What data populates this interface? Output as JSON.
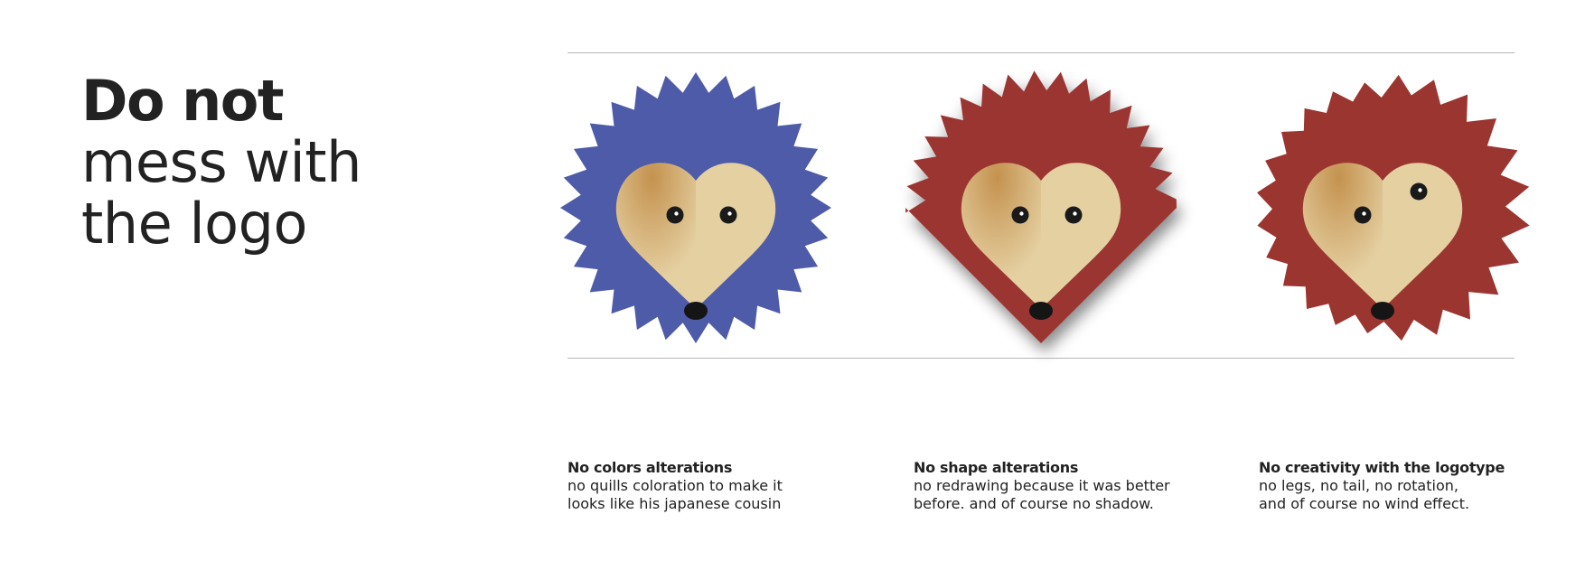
{
  "headline": {
    "line1": "Do not",
    "line2": "mess with",
    "line3": "the logo"
  },
  "colors": {
    "quills_blue": "#4e5ba8",
    "quills_red": "#9b3530",
    "face_light": "#e5d0a2",
    "face_shade": "#c4924f",
    "eye": "#1a1a1a",
    "nose": "#151515",
    "rule": "#b8b8b8",
    "text": "#222222"
  },
  "examples": [
    {
      "title": "No colors alterations",
      "line1": "no quills coloration to make it",
      "line2": "looks like his japanese cousin",
      "icon": "hedgehog-logo-blue-quills"
    },
    {
      "title": "No shape alterations",
      "line1": "no redrawing because it was better",
      "line2": "before. and of course no shadow.",
      "icon": "hedgehog-logo-square-shadow"
    },
    {
      "title": "No creativity with the logotype",
      "line1": "no legs, no tail, no rotation,",
      "line2": "and of course no wind effect.",
      "icon": "hedgehog-logo-wind-effect"
    }
  ]
}
